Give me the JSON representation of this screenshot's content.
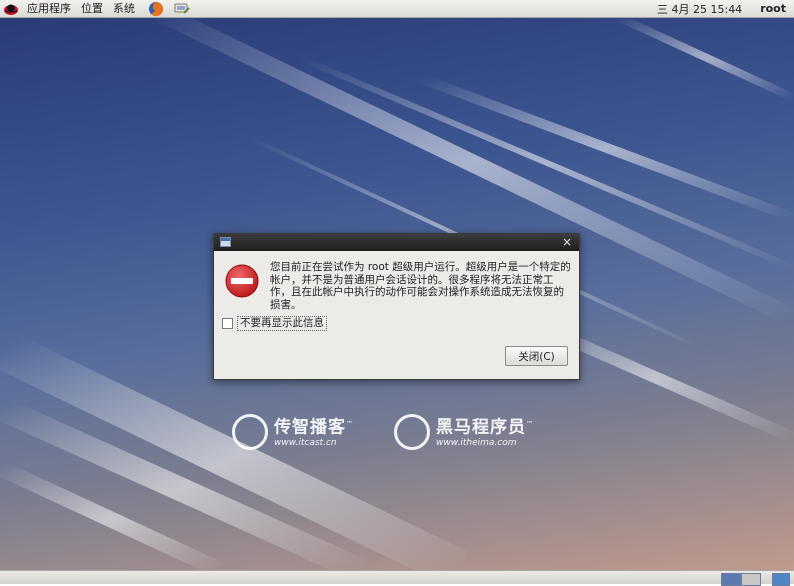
{
  "top_panel": {
    "menus": [
      "应用程序",
      "位置",
      "系统"
    ],
    "clock": "三 4月 25 15:44",
    "user": "root"
  },
  "desktop": {
    "logos": [
      {
        "name": "传智播客",
        "url": "www.itcast.cn"
      },
      {
        "name": "黑马程序员",
        "url": "www.itheima.com"
      }
    ],
    "trademark": "™"
  },
  "dialog": {
    "close_glyph": "×",
    "message": "您目前正在尝试作为 root 超级用户运行。超级用户是一个特定的帐户，并不是为普通用户会话设计的。很多程序将无法正常工作，且在此帐户中执行的动作可能会对操作系统造成无法恢复的损害。",
    "checkbox_label": "不要再显示此信息",
    "checkbox_checked": false,
    "close_button_label": "关闭(C)"
  },
  "colors": {
    "error_red": "#d8262a",
    "dialog_bg": "#edebe8",
    "titlebar": "#2a2a2a"
  },
  "icons": [
    "redhat-icon",
    "firefox-icon",
    "network-icon",
    "dialog-window-icon",
    "error-icon",
    "workspace-icon"
  ]
}
